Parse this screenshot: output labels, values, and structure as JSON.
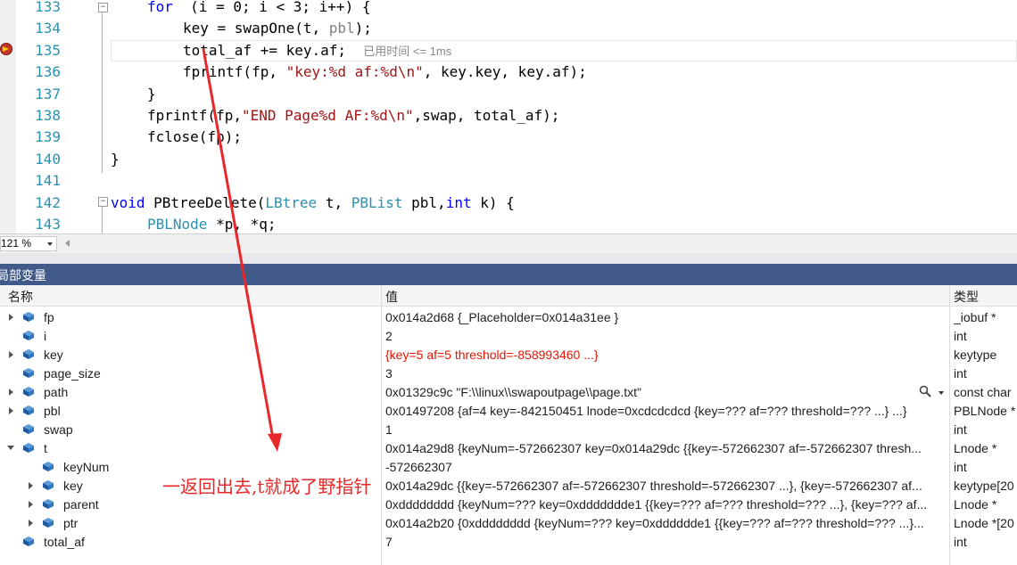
{
  "editor": {
    "lines": [
      {
        "num": "133",
        "parts": [
          [
            "kw",
            "for"
          ],
          [
            "",
            "  (i = 0; i < 3; i++) {"
          ]
        ]
      },
      {
        "num": "134",
        "parts": [
          [
            "",
            "key = swapOne(t, "
          ],
          [
            "param",
            "pbl"
          ],
          [
            "",
            ");"
          ]
        ]
      },
      {
        "num": "135",
        "parts": [
          [
            "",
            "total_af += key.af;  "
          ],
          [
            "hint",
            "已用时间 <= 1ms"
          ]
        ]
      },
      {
        "num": "136",
        "parts": [
          [
            "",
            "fprintf(fp, "
          ],
          [
            "str",
            "\"key:%d af:%d\\n\""
          ],
          [
            "",
            ", key.key, key.af);"
          ]
        ]
      },
      {
        "num": "137",
        "parts": [
          [
            "",
            "}"
          ]
        ]
      },
      {
        "num": "138",
        "parts": [
          [
            "",
            "fprintf(fp,"
          ],
          [
            "str",
            "\"END Page%d AF:%d\\n\""
          ],
          [
            "",
            ",swap, total_af);"
          ]
        ]
      },
      {
        "num": "139",
        "parts": [
          [
            "",
            "fclose(fp);"
          ]
        ]
      },
      {
        "num": "140",
        "parts": [
          [
            "",
            "}"
          ]
        ]
      },
      {
        "num": "141",
        "parts": []
      },
      {
        "num": "142",
        "parts": [
          [
            "kw",
            "void"
          ],
          [
            "",
            " PBtreeDelete("
          ],
          [
            "ty",
            "LBtree"
          ],
          [
            "",
            " t, "
          ],
          [
            "ty",
            "PBList"
          ],
          [
            "",
            " pbl,"
          ],
          [
            "kw",
            "int"
          ],
          [
            "",
            " k) {"
          ]
        ]
      },
      {
        "num": "143",
        "parts": [
          [
            "ty",
            "PBLNode"
          ],
          [
            "",
            " *p, *q;"
          ]
        ]
      }
    ]
  },
  "zoom": {
    "value": "121 %"
  },
  "panel": {
    "title": "局部变量"
  },
  "locals": {
    "columns": {
      "name": "名称",
      "value": "值",
      "type": "类型"
    },
    "rows": [
      {
        "name": "fp",
        "value": "0x014a2d68 {_Placeholder=0x014a31ee }",
        "type": "_iobuf *"
      },
      {
        "name": "i",
        "value": "2",
        "type": "int"
      },
      {
        "name": "key",
        "value": "{key=5 af=5 threshold=-858993460 ...}",
        "type": "keytype"
      },
      {
        "name": "page_size",
        "value": "3",
        "type": "int"
      },
      {
        "name": "path",
        "value": "0x01329c9c \"F:\\\\linux\\\\swapoutpage\\\\page.txt\"",
        "type": "const char"
      },
      {
        "name": "pbl",
        "value": "0x01497208 {af=4 key=-842150451 lnode=0xcdcdcdcd {key=??? af=??? threshold=??? ...} ...}",
        "type": "PBLNode *"
      },
      {
        "name": "swap",
        "value": "1",
        "type": "int"
      },
      {
        "name": "t",
        "value": "0x014a29d8 {keyNum=-572662307 key=0x014a29dc {{key=-572662307 af=-572662307 thresh...",
        "type": "Lnode *"
      },
      {
        "name": "keyNum",
        "value": "-572662307",
        "type": "int"
      },
      {
        "name": "key",
        "value": "0x014a29dc {{key=-572662307 af=-572662307 threshold=-572662307 ...}, {key=-572662307 af...",
        "type": "keytype[20"
      },
      {
        "name": "parent",
        "value": "0xdddddddd {keyNum=??? key=0xddddddde1 {{key=??? af=??? threshold=??? ...}, {key=??? af...",
        "type": "Lnode *"
      },
      {
        "name": "ptr",
        "value": "0x014a2b20 {0xdddddddd {keyNum=??? key=0xdddddde1 {{key=??? af=??? threshold=??? ...}...",
        "type": "Lnode *[20"
      },
      {
        "name": "total_af",
        "value": "7",
        "type": "int"
      }
    ]
  },
  "annotation": {
    "text": "一返回出去,t就成了野指针",
    "color": "#e8282a"
  },
  "colors": {
    "panel_header": "#425a8a",
    "line_number": "#2b91af",
    "keyword": "#0000ff",
    "changed_value": "#e51400"
  }
}
